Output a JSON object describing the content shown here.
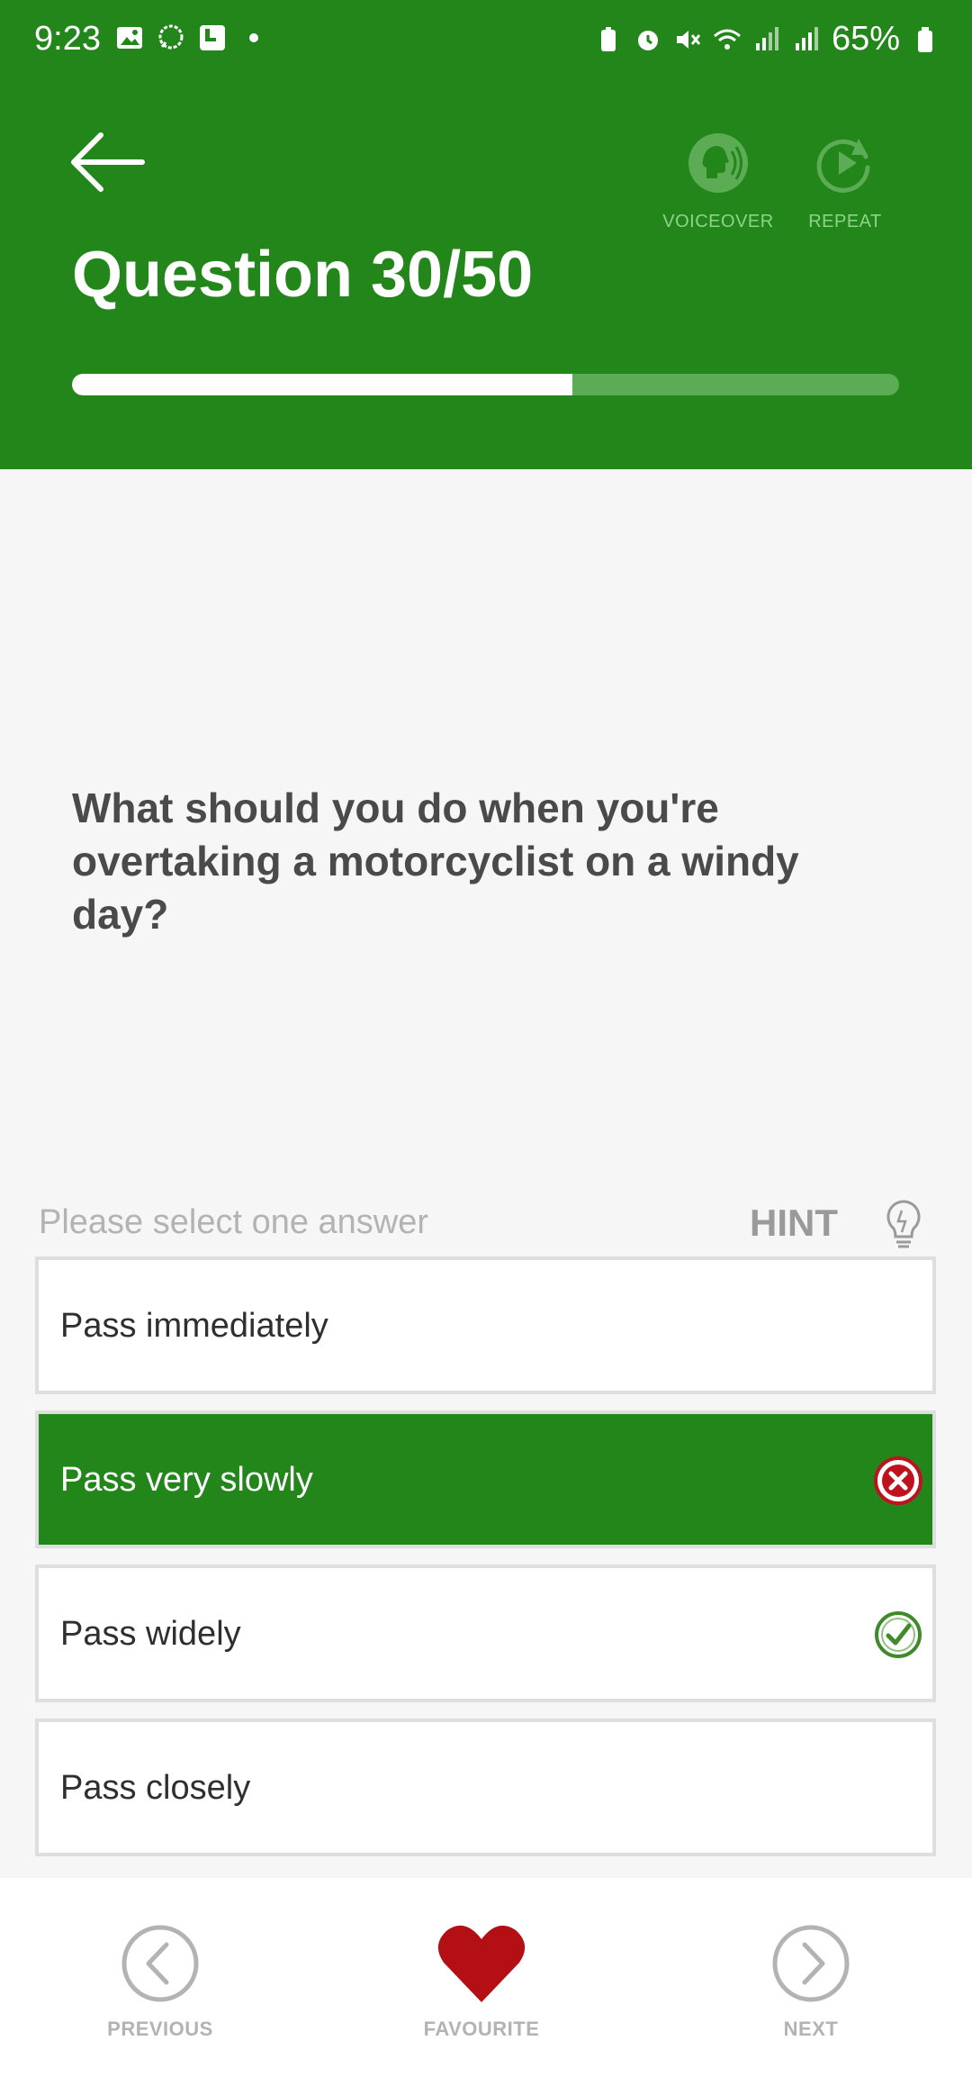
{
  "status_bar": {
    "time": "9:23",
    "battery": "65%"
  },
  "header": {
    "title": "Question 30/50",
    "voiceover_label": "VOICEOVER",
    "repeat_label": "REPEAT",
    "progress": 0.605
  },
  "question": {
    "text": "What should you do when you're overtaking a motorcyclist on a windy day?"
  },
  "answers_section": {
    "prompt": "Please select one answer",
    "hint_label": "HINT"
  },
  "answers": [
    {
      "label": "Pass immediately",
      "state": "none"
    },
    {
      "label": "Pass very slowly",
      "state": "selected-wrong"
    },
    {
      "label": "Pass widely",
      "state": "correct"
    },
    {
      "label": "Pass closely",
      "state": "none"
    }
  ],
  "bottom_nav": {
    "previous": "PREVIOUS",
    "favourite": "FAVOURITE",
    "next": "NEXT"
  },
  "colors": {
    "primary_green": "#23861a",
    "wrong_red": "#c0111f",
    "correct_green": "#3f8a2a",
    "favourite_red": "#b30f14"
  }
}
